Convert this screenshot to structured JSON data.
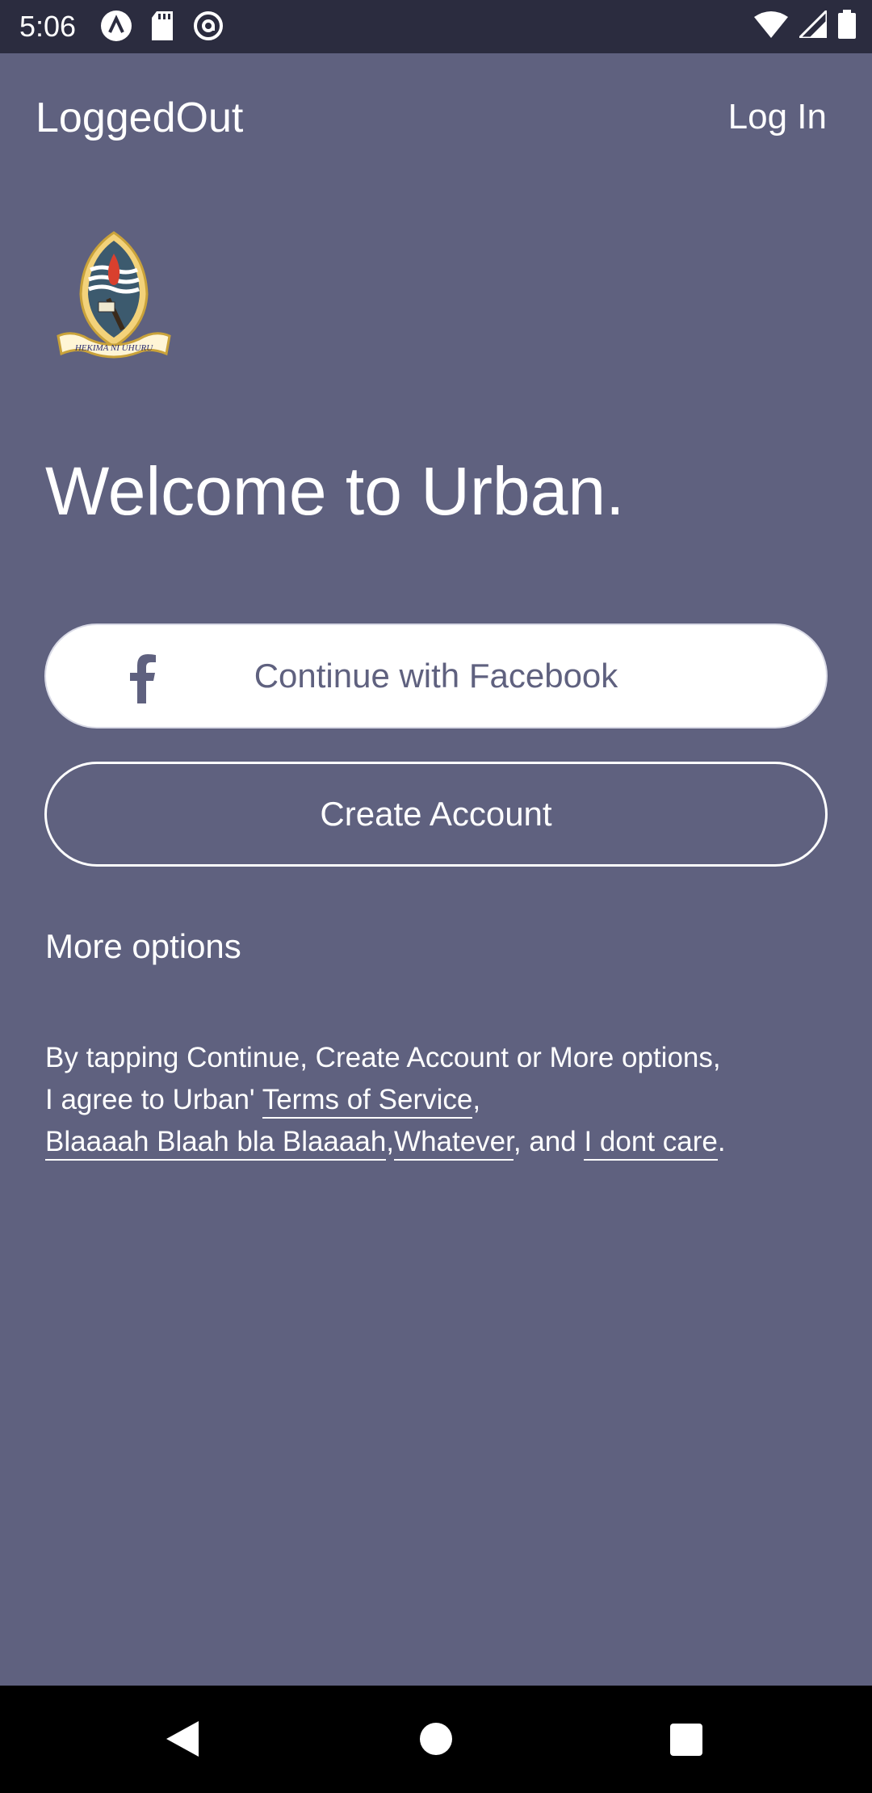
{
  "status_bar": {
    "time": "5:06",
    "left_icons": [
      "notification-a-icon",
      "sd-card-icon",
      "at-sign-icon"
    ],
    "right_icons": [
      "wifi-icon",
      "signal-icon",
      "battery-icon"
    ]
  },
  "app_bar": {
    "title": "LoggedOut",
    "login_label": "Log In"
  },
  "logo": {
    "motto": "HEKIMA NI UHURU"
  },
  "welcome_text": "Welcome to Urban.",
  "buttons": {
    "facebook_label": "Continue with Facebook",
    "create_account_label": "Create Account"
  },
  "more_options_label": "More options",
  "terms": {
    "intro": "By tapping Continue, Create Account or More options,",
    "line2_prefix": "I agree to Urban' ",
    "terms_of_service": "Terms of Service",
    "comma": ",",
    "link_blah": "Blaaaah Blaah bla Blaaaah",
    "link_whatever": "Whatever",
    "and_text": ", and ",
    "link_dont_care": "I dont care",
    "period": "."
  },
  "colors": {
    "background": "#5f617f",
    "status_bar": "#2b2c3f",
    "accent_text": "#5f617f",
    "white": "#ffffff"
  }
}
